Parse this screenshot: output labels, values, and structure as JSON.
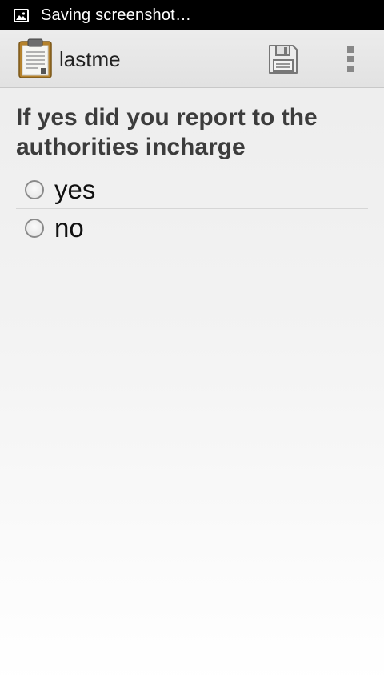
{
  "status_bar": {
    "text": "Saving screenshot…",
    "icon": "image-icon"
  },
  "action_bar": {
    "title": "lastme",
    "app_icon": "clipboard-icon",
    "save_icon": "floppy-disk-icon",
    "overflow_icon": "overflow-menu-icon"
  },
  "form": {
    "question": "If yes did you report to the authorities incharge",
    "options": [
      {
        "label": "yes",
        "selected": false
      },
      {
        "label": "no",
        "selected": false
      }
    ]
  },
  "colors": {
    "status_bar_bg": "#000000",
    "action_bar_bg": "#e8e8e8",
    "question_text": "#3c3c3c",
    "clipboard_brown": "#b5822c"
  }
}
